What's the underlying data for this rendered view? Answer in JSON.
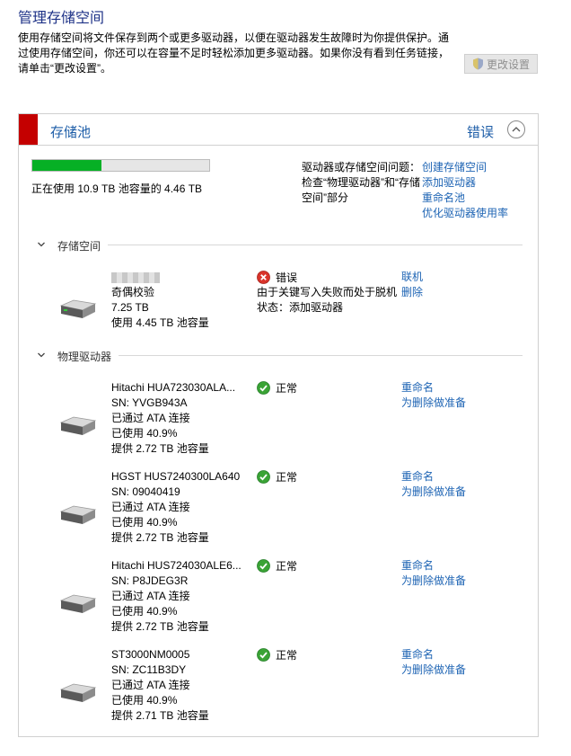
{
  "header": {
    "title": "管理存储空间",
    "description_lines": [
      "使用存储空间将文件保存到两个或更多驱动器，以便在驱动器发生故障时为你提供保护。通",
      "过使用存储空间，你还可以在容量不足时轻松添加更多驱动器。如果你没有看到任务链接，",
      "请单击“更改设置”。"
    ],
    "change_settings_label": "更改设置"
  },
  "pool": {
    "title": "存储池",
    "status": "错误",
    "usage_fraction": 0.39,
    "usage_text": "正在使用 10.9 TB 池容量的 4.46 TB",
    "issue_lines": [
      "驱动器或存储空间问题：",
      "检查“物理驱动器”和“存储",
      "空间”部分"
    ],
    "actions": [
      "创建存储空间",
      "添加驱动器",
      "重命名池",
      "优化驱动器使用率"
    ]
  },
  "spaces_section": {
    "title": "存储空间",
    "space": {
      "lines": [
        "奇偶校验",
        "7.25 TB",
        "使用 4.45 TB 池容量"
      ],
      "status_label": "错误",
      "status_detail": [
        "由于关键写入失败而处于脱机",
        "状态：添加驱动器"
      ],
      "links": [
        "联机",
        "删除"
      ]
    }
  },
  "drives_section": {
    "title": "物理驱动器",
    "drives": [
      {
        "lines": [
          "Hitachi HUA723030ALA...",
          "SN: YVGB943A",
          "已通过 ATA 连接",
          "已使用 40.9%",
          "提供 2.72 TB 池容量"
        ],
        "status": "正常",
        "links": [
          "重命名",
          "为删除做准备"
        ]
      },
      {
        "lines": [
          "HGST HUS7240300LA640",
          "SN: 09040419",
          "已通过 ATA 连接",
          "已使用 40.9%",
          "提供 2.72 TB 池容量"
        ],
        "status": "正常",
        "links": [
          "重命名",
          "为删除做准备"
        ]
      },
      {
        "lines": [
          "Hitachi HUS724030ALE6...",
          "SN: P8JDEG3R",
          "已通过 ATA 连接",
          "已使用 40.9%",
          "提供 2.72 TB 池容量"
        ],
        "status": "正常",
        "links": [
          "重命名",
          "为删除做准备"
        ]
      },
      {
        "lines": [
          "ST3000NM0005",
          "SN: ZC11B3DY",
          "已通过 ATA 连接",
          "已使用 40.9%",
          "提供 2.71 TB 池容量"
        ],
        "status": "正常",
        "links": [
          "重命名",
          "为删除做准备"
        ]
      }
    ]
  },
  "colors": {
    "error_red": "#c40000",
    "ok_green": "#06b025",
    "link_blue": "#1e64b4",
    "title_blue": "#1e3287"
  }
}
